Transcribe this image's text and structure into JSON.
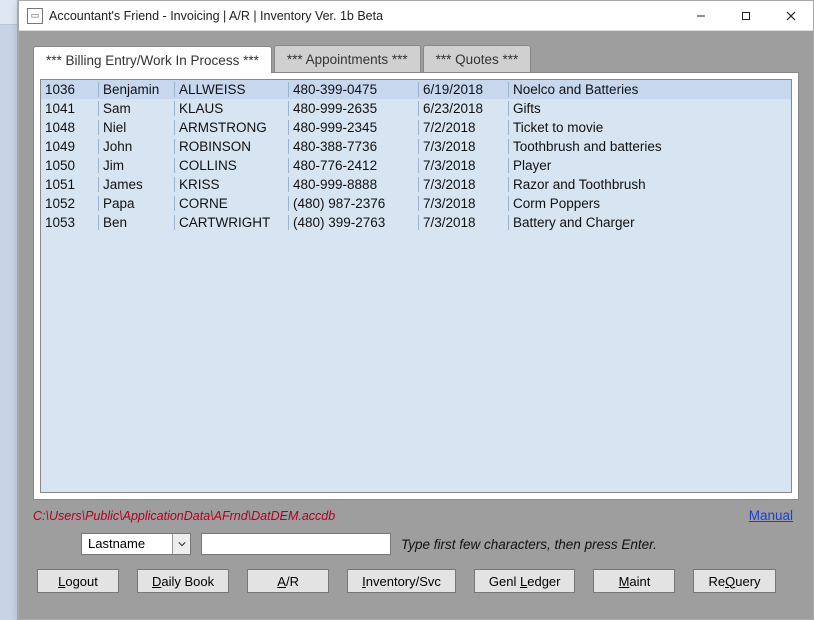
{
  "window": {
    "title": "Accountant's Friend - Invoicing | A/R | Inventory Ver. 1b Beta"
  },
  "tabs": {
    "billing": "*** Billing Entry/Work In Process ***",
    "appointments": "*** Appointments ***",
    "quotes": "*** Quotes ***"
  },
  "grid": {
    "rows": [
      {
        "id": "1036",
        "first": "Benjamin",
        "last": "ALLWEISS",
        "phone": "480-399-0475",
        "date": "6/19/2018",
        "desc": "Noelco and Batteries",
        "selected": true
      },
      {
        "id": "1041",
        "first": "Sam",
        "last": "KLAUS",
        "phone": "480-999-2635",
        "date": "6/23/2018",
        "desc": "Gifts"
      },
      {
        "id": "1048",
        "first": "Niel",
        "last": "ARMSTRONG",
        "phone": "480-999-2345",
        "date": "7/2/2018",
        "desc": "Ticket to movie"
      },
      {
        "id": "1049",
        "first": "John",
        "last": "ROBINSON",
        "phone": "480-388-7736",
        "date": "7/3/2018",
        "desc": "Toothbrush and batteries"
      },
      {
        "id": "1050",
        "first": "Jim",
        "last": "COLLINS",
        "phone": "480-776-2412",
        "date": "7/3/2018",
        "desc": "Player"
      },
      {
        "id": "1051",
        "first": "James",
        "last": "KRISS",
        "phone": "480-999-8888",
        "date": "7/3/2018",
        "desc": "Razor and Toothbrush"
      },
      {
        "id": "1052",
        "first": "Papa",
        "last": "CORNE",
        "phone": "(480) 987-2376",
        "date": "7/3/2018",
        "desc": "Corm Poppers"
      },
      {
        "id": "1053",
        "first": "Ben",
        "last": "CARTWRIGHT",
        "phone": "(480) 399-2763",
        "date": "7/3/2018",
        "desc": "Battery and Charger"
      }
    ]
  },
  "footer": {
    "dbpath": "C:\\Users\\Public\\ApplicationData\\AFrnd\\DatDEM.accdb",
    "manual": "Manual",
    "filter_field": "Lastname",
    "search_value": "",
    "search_placeholder": "",
    "hint": "Type first few characters, then press Enter."
  },
  "buttons": {
    "logout": "ogout",
    "daily": "aily Book",
    "ar": "/R",
    "inventory": "nventory/Svc",
    "gl": "Genl ",
    "gl2": "edger",
    "maint": "aint",
    "requery": "uery",
    "requery_pre": "Re"
  }
}
